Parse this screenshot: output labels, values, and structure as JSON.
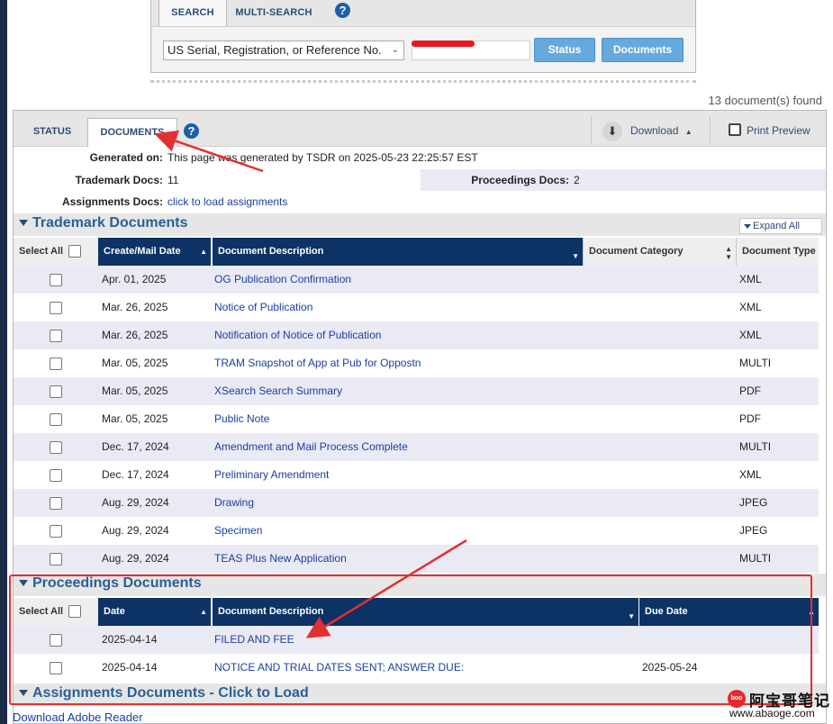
{
  "search_panel": {
    "tabs": [
      "SEARCH",
      "MULTI-SEARCH"
    ],
    "help_icon": "?",
    "select_value": "US Serial, Registration, or Reference No.",
    "search_input_value": "",
    "status_button": "Status",
    "documents_button": "Documents"
  },
  "doc_count": "13 document(s) found",
  "main_tabs": {
    "status": "STATUS",
    "documents": "DOCUMENTS",
    "help": "?"
  },
  "toolbar": {
    "download": "Download",
    "print_preview": "Print Preview"
  },
  "info": {
    "generated_label": "Generated on:",
    "generated_value": "This page was generated by TSDR on 2025-05-23 22:25:57 EST",
    "trademark_docs_label": "Trademark Docs:",
    "trademark_docs_value": "11",
    "proceedings_docs_label": "Proceedings Docs:",
    "proceedings_docs_value": "2",
    "assignments_docs_label": "Assignments Docs:",
    "assignments_docs_link": "click to load assignments"
  },
  "trademark_section": {
    "title": "Trademark Documents",
    "expand_all": "Expand All",
    "columns": {
      "select_all": "Select All",
      "date": "Create/Mail Date",
      "description": "Document Description",
      "category": "Document Category",
      "type": "Document Type"
    },
    "rows": [
      {
        "date": "Apr. 01, 2025",
        "description": "OG Publication Confirmation",
        "type": "XML"
      },
      {
        "date": "Mar. 26, 2025",
        "description": "Notice of Publication",
        "type": "XML"
      },
      {
        "date": "Mar. 26, 2025",
        "description": "Notification of Notice of Publication",
        "type": "XML"
      },
      {
        "date": "Mar. 05, 2025",
        "description": "TRAM Snapshot of App at Pub for Oppostn",
        "type": "MULTI"
      },
      {
        "date": "Mar. 05, 2025",
        "description": "XSearch Search Summary",
        "type": "PDF"
      },
      {
        "date": "Mar. 05, 2025",
        "description": "Public Note",
        "type": "PDF"
      },
      {
        "date": "Dec. 17, 2024",
        "description": "Amendment and Mail Process Complete",
        "type": "MULTI"
      },
      {
        "date": "Dec. 17, 2024",
        "description": "Preliminary Amendment",
        "type": "XML"
      },
      {
        "date": "Aug. 29, 2024",
        "description": "Drawing",
        "type": "JPEG"
      },
      {
        "date": "Aug. 29, 2024",
        "description": "Specimen",
        "type": "JPEG"
      },
      {
        "date": "Aug. 29, 2024",
        "description": "TEAS Plus New Application",
        "type": "MULTI"
      }
    ]
  },
  "proceedings_section": {
    "title": "Proceedings Documents",
    "columns": {
      "select_all": "Select All",
      "date": "Date",
      "description": "Document Description",
      "due": "Due Date"
    },
    "rows": [
      {
        "date": "2025-04-14",
        "description": "FILED AND FEE",
        "due": ""
      },
      {
        "date": "2025-04-14",
        "description": "NOTICE AND TRIAL DATES SENT; ANSWER DUE:",
        "due": "2025-05-24"
      }
    ]
  },
  "assignments_section": {
    "title": "Assignments Documents - Click to Load"
  },
  "footer": {
    "adobe_link": "Download Adobe Reader"
  },
  "watermark": {
    "logo": "boo",
    "cn": "阿宝哥笔记",
    "url": "www.abaoge.com"
  },
  "colors": {
    "header_dark": "#0c3266",
    "link": "#1a3ea0",
    "accent_button": "#65a9dd",
    "annotation_red": "#e23030"
  }
}
